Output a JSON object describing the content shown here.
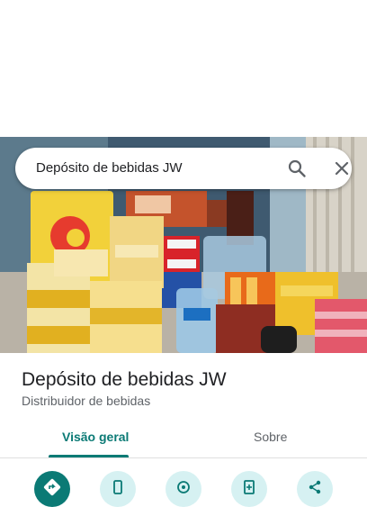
{
  "search": {
    "query": "Depósito de bebidas JW",
    "search_icon": "search-icon",
    "close_icon": "close-icon"
  },
  "photo": {
    "subject": "store-photo"
  },
  "place": {
    "name": "Depósito de bebidas JW",
    "category": "Distribuidor de bebidas"
  },
  "tabs": [
    {
      "label": "Visão geral",
      "active": true
    },
    {
      "label": "Sobre",
      "active": false
    }
  ],
  "actions": [
    {
      "icon": "directions-icon"
    },
    {
      "icon": "phone-icon"
    },
    {
      "icon": "location-icon"
    },
    {
      "icon": "save-icon"
    },
    {
      "icon": "share-icon"
    }
  ],
  "colors": {
    "accent": "#0b7a75",
    "action_bg": "#d6f1f2"
  }
}
